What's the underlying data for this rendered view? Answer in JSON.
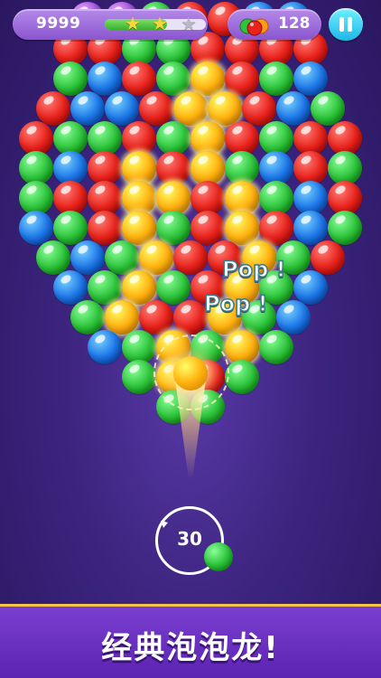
{
  "hud": {
    "score": "9999",
    "progress": 0.62,
    "stars": {
      "earned": 2,
      "total": 3
    },
    "fruit_count": "128"
  },
  "board": {
    "color_key": {
      "R": "#e8231c",
      "G": "#2ec43c",
      "B": "#1e78e8",
      "Y": "#ffb20f",
      "P": "#9a4fd8"
    },
    "rows": [
      "PPGRRBB",
      "RRGGRRRR",
      "GBRGYRGB",
      "RBBRYYRBG",
      "RGGRGYRGRR",
      "GBRYRYGBRG",
      "GRRYYRYGBR",
      "BGRYGRYRBG",
      "GBGYRRYGR",
      "BGYGRYGB",
      "GYRRYGB",
      "BGYGYG",
      "GYRG",
      "GG"
    ],
    "highlighted": [
      "2,4",
      "3,4",
      "3,5",
      "4,5",
      "5,3",
      "5,5",
      "6,3",
      "6,4",
      "6,6",
      "7,3",
      "7,6",
      "8,3",
      "8,6",
      "9,2",
      "9,5",
      "10,1",
      "10,4",
      "11,2",
      "11,4",
      "12,1"
    ]
  },
  "effects": {
    "pop_1": "Pop !",
    "pop_2": "Pop !"
  },
  "shooter": {
    "shots_left": "30",
    "current_color": "Y",
    "next_color": "G"
  },
  "banner": {
    "text": "经典泡泡龙!"
  }
}
